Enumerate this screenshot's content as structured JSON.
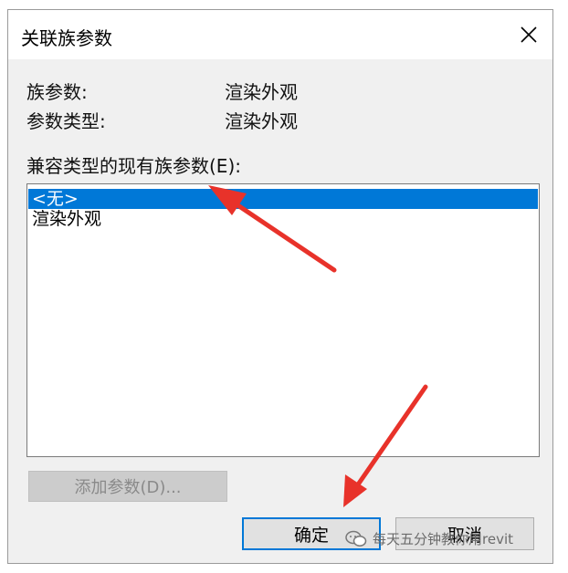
{
  "dialog": {
    "title": "关联族参数",
    "family_param_label": "族参数:",
    "family_param_value": "渲染外观",
    "param_type_label": "参数类型:",
    "param_type_value": "渲染外观",
    "list_label": "兼容类型的现有族参数(E):",
    "list_items": [
      "<无>",
      "渲染外观"
    ],
    "selected_index": 0,
    "add_param_label": "添加参数(D)...",
    "ok_label": "确定",
    "cancel_label": "取消"
  },
  "watermark": {
    "text": "每天五分钟教你用revit",
    "icon": "wechat-icon"
  },
  "colors": {
    "selection": "#0078d7",
    "arrow": "#e8322a"
  }
}
